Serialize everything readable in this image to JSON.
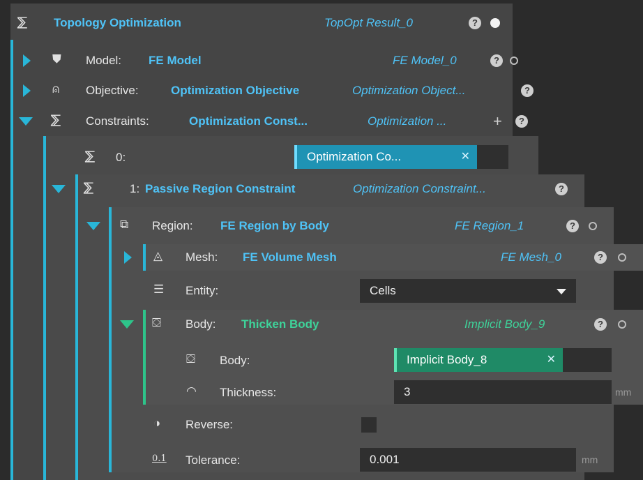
{
  "root": {
    "title": "Topology Optimization",
    "result": "TopOpt Result_0",
    "help": "?"
  },
  "model": {
    "label": "Model:",
    "type": "FE Model",
    "value": "FE Model_0"
  },
  "objective": {
    "label": "Objective:",
    "type": "Optimization Objective",
    "value": "Optimization Object..."
  },
  "constraints": {
    "label": "Constraints:",
    "type": "Optimization Const...",
    "value": "Optimization ...",
    "add": "+"
  },
  "constraint0": {
    "label": "0:",
    "chip": "Optimization Co...",
    "chip_x": "✕"
  },
  "constraint1": {
    "label": "1:",
    "type": "Passive Region Constraint",
    "value": "Optimization Constraint..."
  },
  "region": {
    "label": "Region:",
    "type": "FE Region by Body",
    "value": "FE Region_1"
  },
  "mesh": {
    "label": "Mesh:",
    "type": "FE Volume Mesh",
    "value": "FE Mesh_0"
  },
  "entity": {
    "label": "Entity:",
    "selected": "Cells"
  },
  "body": {
    "label": "Body:",
    "type": "Thicken Body",
    "value": "Implicit Body_9"
  },
  "body_input": {
    "label": "Body:",
    "chip": "Implicit Body_8",
    "chip_x": "✕"
  },
  "thickness": {
    "label": "Thickness:",
    "value": "3",
    "unit": "mm"
  },
  "reverse": {
    "label": "Reverse:"
  },
  "tolerance": {
    "label": "Tolerance:",
    "value": "0.001",
    "unit": "mm",
    "icon_text": "0.1"
  },
  "colors": {
    "accent_blue": "#29b6d8",
    "accent_green": "#2ec48a",
    "text_blue": "#4fc3f7",
    "text_green": "#3ed39a"
  }
}
